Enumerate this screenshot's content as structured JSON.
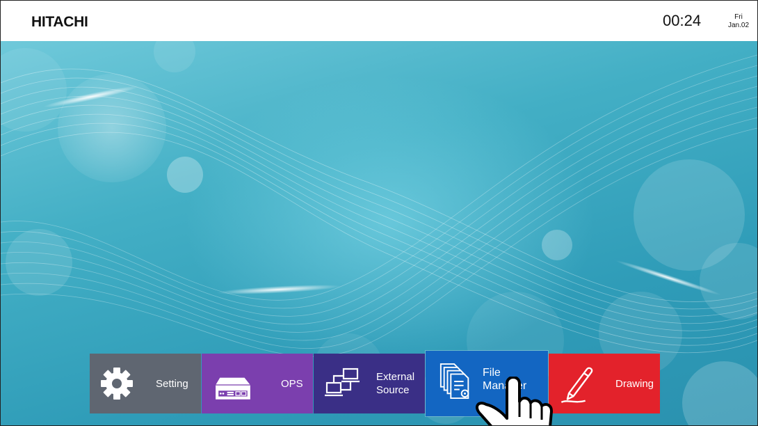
{
  "header": {
    "brand": "HITACHI",
    "time": "00:24",
    "day": "Fri",
    "date": "Jan.02"
  },
  "tiles": [
    {
      "label_lines": [
        "Setting"
      ],
      "icon": "gear-icon",
      "color": "#5f6671"
    },
    {
      "label_lines": [
        "OPS"
      ],
      "icon": "ops-box-icon",
      "color": "#7b3fae"
    },
    {
      "label_lines": [
        "External",
        "Source"
      ],
      "icon": "external-source-icon",
      "color": "#3a2f86"
    },
    {
      "label_lines": [
        "File",
        "Manager"
      ],
      "icon": "file-manager-icon",
      "color": "#1366c2",
      "selected": true
    },
    {
      "label_lines": [
        "Drawing"
      ],
      "icon": "pen-icon",
      "color": "#e3222b"
    }
  ],
  "overlay": {
    "icon": "pointing-hand-icon"
  }
}
